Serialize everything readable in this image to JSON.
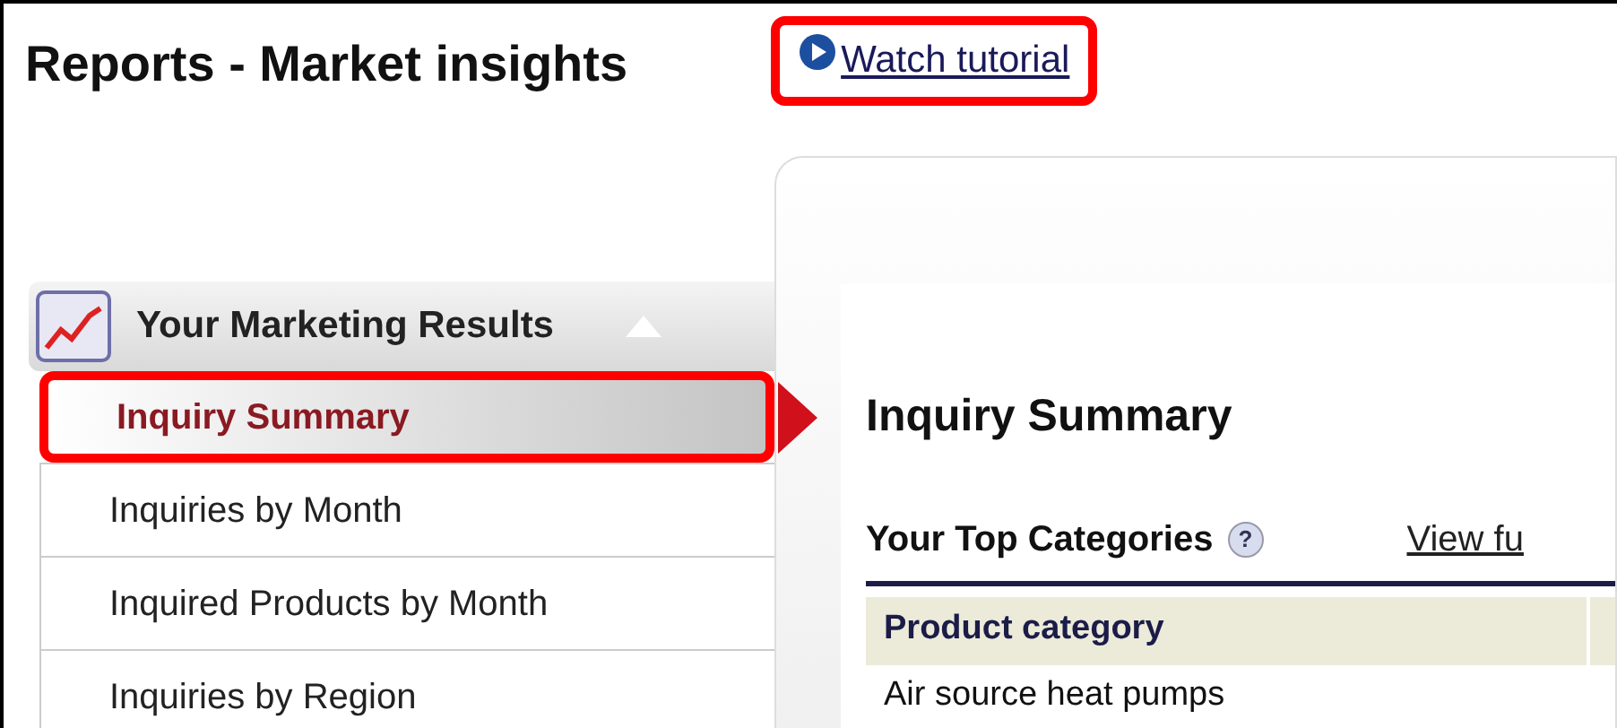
{
  "page": {
    "title": "Reports - Market insights"
  },
  "tutorial_link": {
    "label": "Watch tutorial",
    "highlighted": true
  },
  "sidebar": {
    "section": {
      "title": "Your Marketing Results",
      "expanded": true
    },
    "items": [
      {
        "label": "Inquiry Summary",
        "selected": true,
        "highlighted": true
      },
      {
        "label": "Inquiries by Month",
        "selected": false,
        "highlighted": false
      },
      {
        "label": "Inquired Products by Month",
        "selected": false,
        "highlighted": false
      },
      {
        "label": "Inquiries by Region",
        "selected": false,
        "highlighted": false
      }
    ]
  },
  "content": {
    "heading": "Inquiry Summary",
    "section_title": "Your Top Categories",
    "help": "?",
    "link": "View fu",
    "table": {
      "columns": [
        "Product category"
      ],
      "rows": [
        [
          "Air source heat pumps"
        ]
      ]
    }
  }
}
